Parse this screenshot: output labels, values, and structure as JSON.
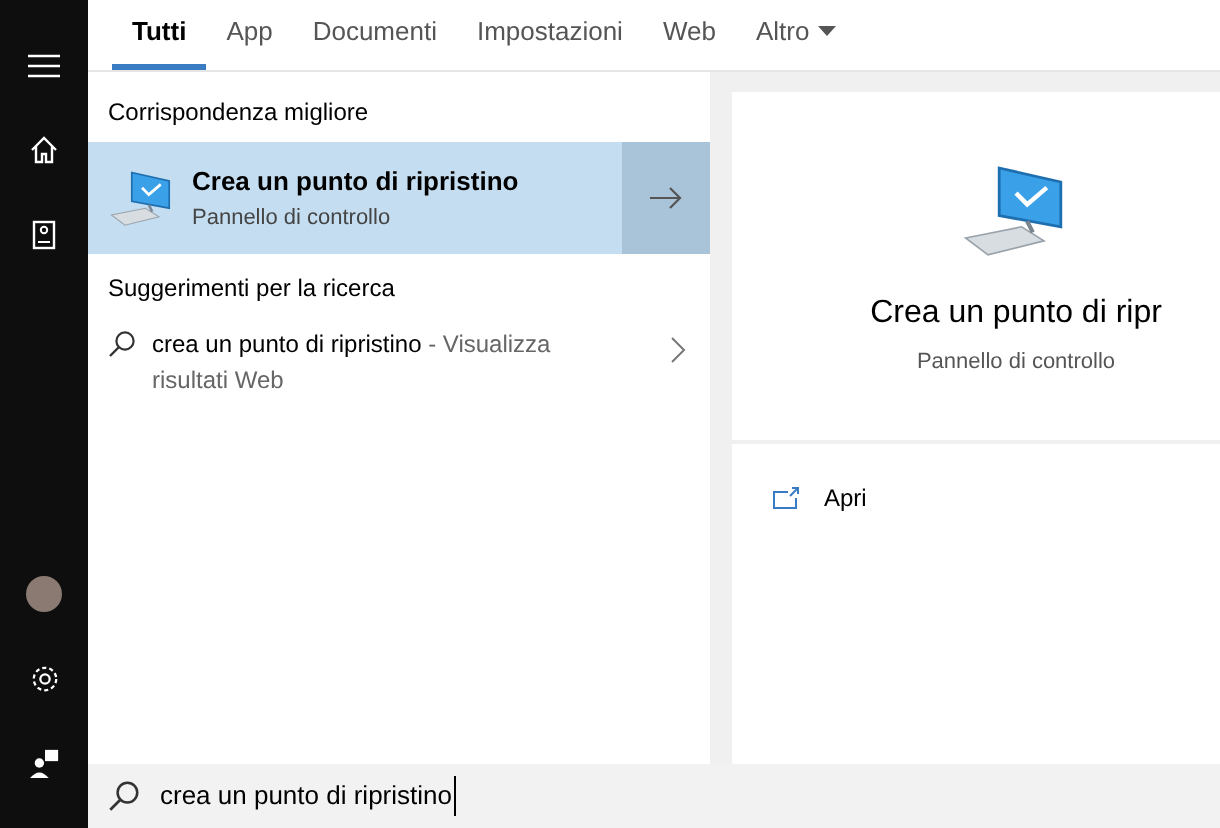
{
  "sidebar": {
    "items": [
      {
        "kind": "menu"
      },
      {
        "kind": "home"
      },
      {
        "kind": "notebook"
      },
      {
        "kind": "spacer"
      },
      {
        "kind": "avatar"
      },
      {
        "kind": "settings"
      },
      {
        "kind": "feedback"
      }
    ]
  },
  "tabs": [
    {
      "label": "Tutti",
      "selected": true
    },
    {
      "label": "App",
      "selected": false
    },
    {
      "label": "Documenti",
      "selected": false
    },
    {
      "label": "Impostazioni",
      "selected": false
    },
    {
      "label": "Web",
      "selected": false
    },
    {
      "label": "Altro",
      "selected": false,
      "dropdown": true
    }
  ],
  "best_match": {
    "heading": "Corrispondenza migliore",
    "title": "Crea un punto di ripristino",
    "subtitle": "Pannello di controllo",
    "selected": true
  },
  "suggestions": {
    "heading": "Suggerimenti per la ricerca",
    "items": [
      {
        "query": "crea un punto di ripristino",
        "suffix": " - Visualizza risultati Web"
      }
    ]
  },
  "preview": {
    "title": "Crea un punto di ripr",
    "subtitle": "Pannello di controllo",
    "actions": [
      {
        "label": "Apri"
      }
    ]
  },
  "search": {
    "value": "crea un punto di ripristino"
  }
}
